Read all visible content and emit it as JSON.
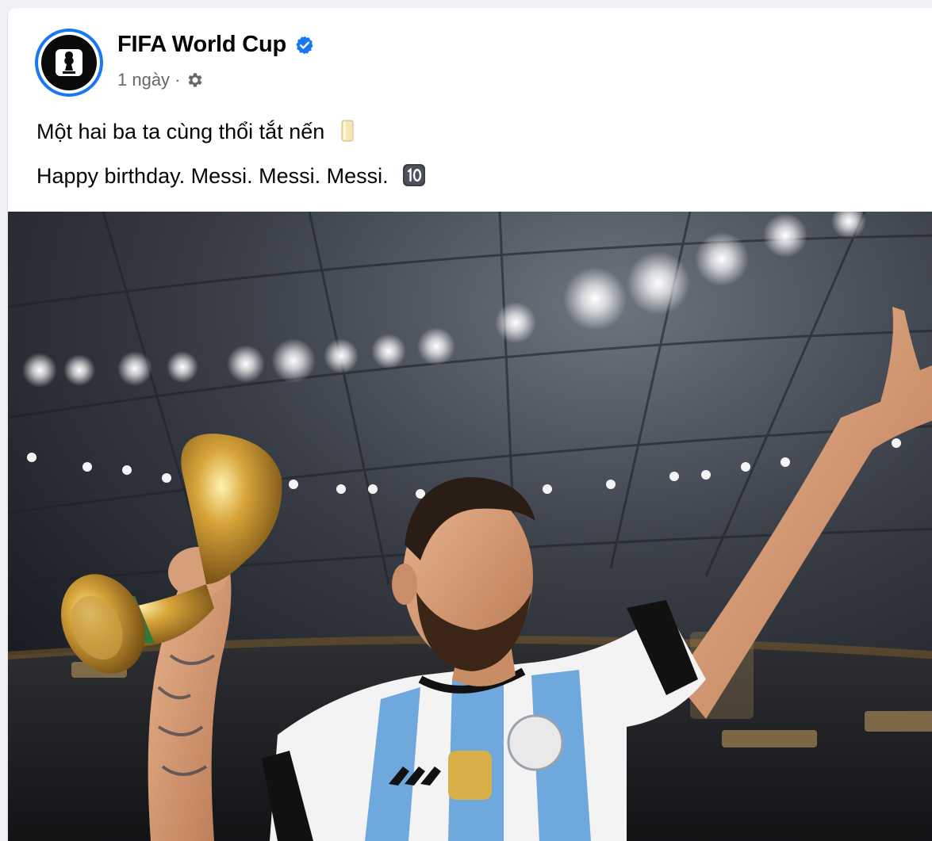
{
  "post": {
    "page_name": "FIFA World Cup",
    "time": "1 ngày",
    "separator": "·",
    "text_line1": "Một hai ba ta cùng thổi tắt nến",
    "text_line2": "Happy birthday. Messi. Messi. Messi.",
    "emoji1": "candle-emoji",
    "emoji2": "keycap-ten-emoji"
  },
  "icons": {
    "verified": "verified-badge-icon",
    "audience": "gear-icon",
    "avatar": "fifa-world-cup-logo"
  },
  "colors": {
    "verified_blue": "#1877f2",
    "meta_gray": "#65676b",
    "page_bg": "#f0f2f5"
  },
  "photo": {
    "description_icon": "photo-image"
  }
}
